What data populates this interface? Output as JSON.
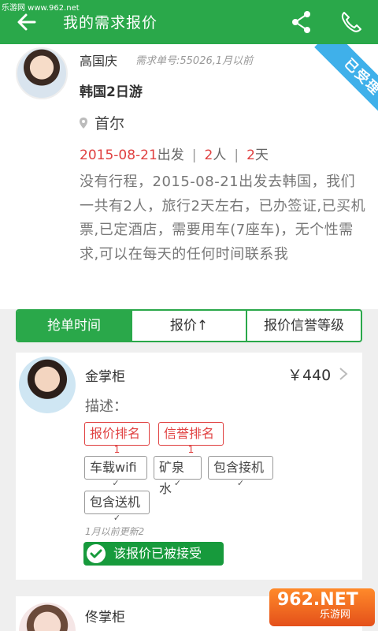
{
  "watermark_top": "乐游网 www.962.net",
  "appbar": {
    "title": "我的需求报价",
    "back_icon": "arrow-left-icon",
    "share_icon": "share-icon",
    "phone_icon": "phone-icon"
  },
  "request": {
    "user_name": "高国庆",
    "meta": "需求单号:55026,1月以前",
    "trip_title": "韩国2日游",
    "location": "首尔",
    "date": "2015-08-21",
    "date_suffix": "出发",
    "people_num": "2",
    "people_unit": "人",
    "days_num": "2",
    "days_unit": "天",
    "description": "没有行程，2015-08-21出发去韩国，我们一共有2人，旅行2天左右，已办签证,已买机票,已定酒店，需要用车(7座车)，无个性需求,可以在每天的任何时间联系我",
    "status_ribbon": "已受理"
  },
  "sort_tabs": [
    {
      "label": "抢单时间"
    },
    {
      "label": "报价↑"
    },
    {
      "label": "报价信誉等级"
    }
  ],
  "quotes": [
    {
      "name": "金掌柜",
      "price": "￥440",
      "desc_label": "描述：",
      "rank_tags": [
        {
          "label": "报价排名",
          "value": "1"
        },
        {
          "label": "信誉排名",
          "value": "1"
        }
      ],
      "service_tags": [
        {
          "label": "车载wifi",
          "mark": "✓"
        },
        {
          "label": "矿泉水",
          "mark": "✓"
        },
        {
          "label": "包含接机",
          "mark": "✓"
        },
        {
          "label": "包含送机",
          "mark": "✓"
        }
      ],
      "updated": "1月以前更新2",
      "accepted_label": "该报价已被接受"
    },
    {
      "name": "佟掌柜"
    }
  ],
  "watermark_logo": {
    "brand": "962.NET",
    "sub": "乐游网"
  },
  "colors": {
    "primary_green": "#2aa84a",
    "accepted_green": "#179a3c",
    "accent_red": "#e04040",
    "ribbon_blue": "#3fb0ea"
  }
}
